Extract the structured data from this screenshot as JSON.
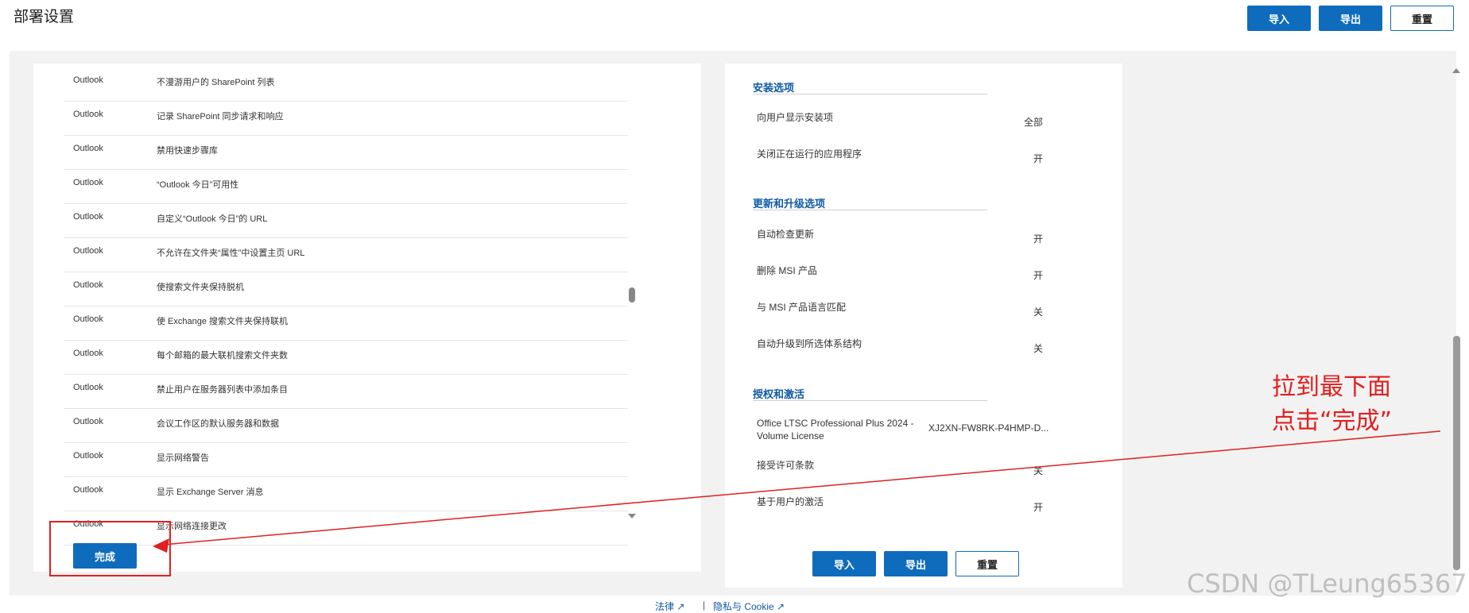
{
  "header": {
    "title": "部署设置",
    "import_label": "导入",
    "export_label": "导出",
    "reset_label": "重置"
  },
  "app_settings": [
    {
      "app": "Outlook",
      "setting": "不漫游用户的 SharePoint 列表"
    },
    {
      "app": "Outlook",
      "setting": "记录 SharePoint 同步请求和响应"
    },
    {
      "app": "Outlook",
      "setting": "禁用快速步骤库"
    },
    {
      "app": "Outlook",
      "setting": "“Outlook 今日”可用性"
    },
    {
      "app": "Outlook",
      "setting": "自定义“Outlook 今日”的 URL"
    },
    {
      "app": "Outlook",
      "setting": "不允许在文件夹“属性”中设置主页 URL"
    },
    {
      "app": "Outlook",
      "setting": "使搜索文件夹保持脱机"
    },
    {
      "app": "Outlook",
      "setting": "使 Exchange 搜索文件夹保持联机"
    },
    {
      "app": "Outlook",
      "setting": "每个邮箱的最大联机搜索文件夹数"
    },
    {
      "app": "Outlook",
      "setting": "禁止用户在服务器列表中添加条目"
    },
    {
      "app": "Outlook",
      "setting": "会议工作区的默认服务器和数据"
    },
    {
      "app": "Outlook",
      "setting": "显示网络警告"
    },
    {
      "app": "Outlook",
      "setting": "显示 Exchange Server 消息"
    },
    {
      "app": "Outlook",
      "setting": "显示网络连接更改"
    }
  ],
  "done_label": "完成",
  "install_options": {
    "title": "安装选项",
    "items": [
      {
        "label": "向用户显示安装项",
        "value": "全部"
      },
      {
        "label": "关闭正在运行的应用程序",
        "value": "开"
      }
    ]
  },
  "update_options": {
    "title": "更新和升级选项",
    "items": [
      {
        "label": "自动检查更新",
        "value": "开"
      },
      {
        "label": "删除 MSI 产品",
        "value": "开"
      },
      {
        "label": "与 MSI 产品语言匹配",
        "value": "关"
      },
      {
        "label": "自动升级到所选体系结构",
        "value": "关"
      }
    ]
  },
  "licensing": {
    "title": "授权和激活",
    "product_line1": "Office LTSC Professional Plus 2024 -",
    "product_line2": "Volume License",
    "product_key": "XJ2XN-FW8RK-P4HMP-D...",
    "items": [
      {
        "label": "接受许可条款",
        "value": "关"
      },
      {
        "label": "基于用户的激活",
        "value": "开"
      }
    ]
  },
  "bottom_buttons": {
    "import_label": "导入",
    "export_label": "导出",
    "reset_label": "重置"
  },
  "footer": {
    "legal": "法律",
    "privacy": "隐私与 Cookie"
  },
  "annotation": {
    "line1": "拉到最下面",
    "line2": "点击“完成”",
    "color": "#e02020"
  },
  "watermark": "CSDN @TLeung65367",
  "colors": {
    "accent": "#0f6cbd",
    "link": "#0f5aa6"
  }
}
